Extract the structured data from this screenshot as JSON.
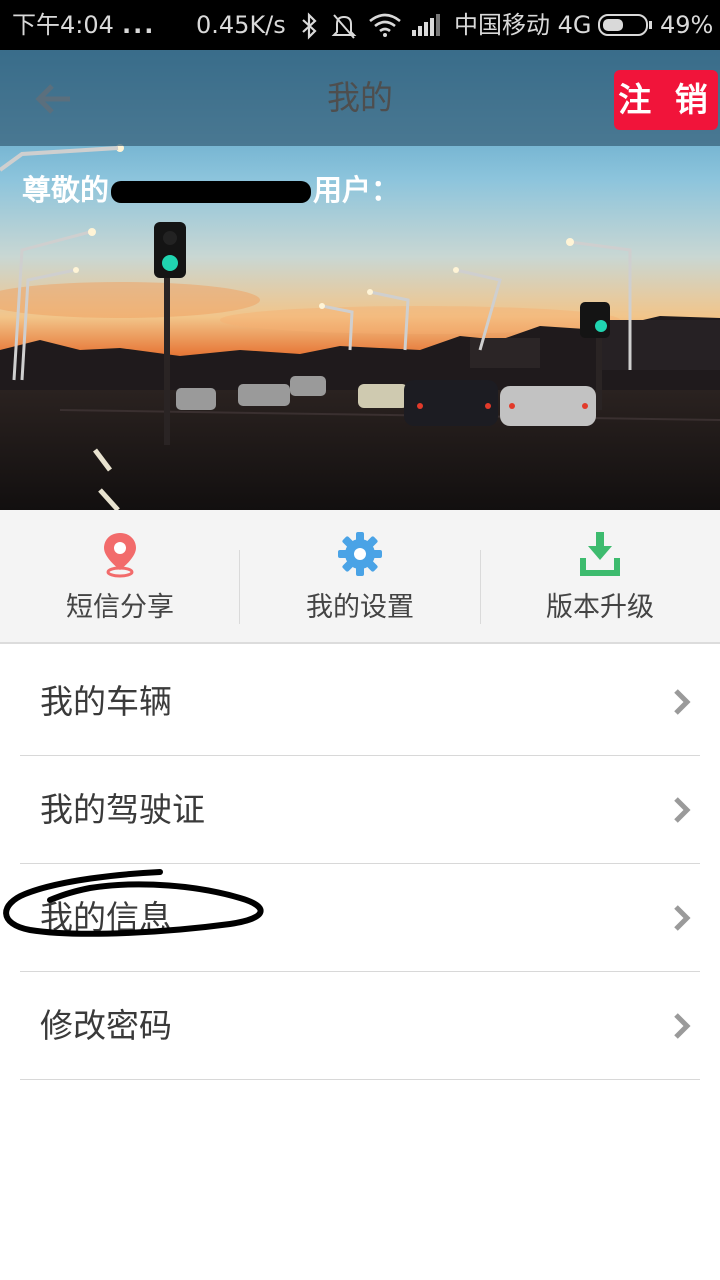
{
  "status_bar": {
    "time": "下午4:04",
    "dots": "...",
    "net_speed": "0.45K/s",
    "carrier": "中国移动 4G",
    "battery": "49%"
  },
  "header": {
    "title": "我的",
    "logout_label": "注 销"
  },
  "hero": {
    "greeting_prefix": "尊敬的",
    "greeting_suffix": "用户："
  },
  "quick_actions": [
    {
      "label": "短信分享",
      "icon": "location-pin-icon",
      "color": "#f26b6b"
    },
    {
      "label": "我的设置",
      "icon": "gear-icon",
      "color": "#4aa3e6"
    },
    {
      "label": "版本升级",
      "icon": "download-tray-icon",
      "color": "#3dbb6e"
    }
  ],
  "menu": [
    {
      "label": "我的车辆"
    },
    {
      "label": "我的驾驶证"
    },
    {
      "label": "我的信息"
    },
    {
      "label": "修改密码"
    }
  ],
  "colors": {
    "logout_bg": "#f1143a",
    "appbar_bg": "#375f78"
  }
}
